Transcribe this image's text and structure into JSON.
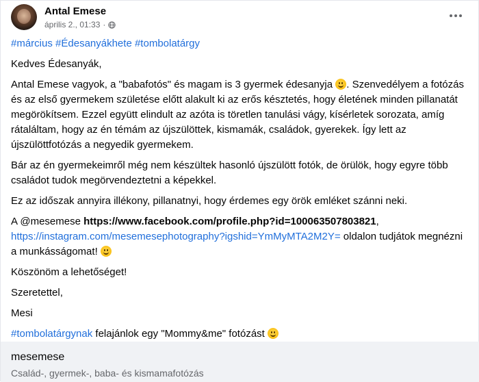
{
  "post": {
    "author": "Antal Emese",
    "timestamp": "április 2., 01:33",
    "separator": "·",
    "privacy_icon": "globe-icon",
    "more_icon": "more-options-icon",
    "hashtags": [
      "#március",
      "#Édesanyákhete",
      "#tombolatárgy"
    ],
    "greeting": "Kedves Édesanyák,",
    "p1_a": "Antal Emese vagyok, a \"babafotós\" és magam is 3 gyermek édesanyja ",
    "p1_b": ". Szenvedélyem a fotózás és az első gyermekem születése előtt alakult ki az erős késztetés, hogy életének minden pillanatát megörökítsem. Ezzel együtt elindult az azóta is töretlen tanulási vágy, kísérletek sorozata, amíg rátaláltam, hogy az én témám az újszülöttek, kismamák, családok, gyerekek. Így lett az újszülöttfotózás a negyedik gyermekem.",
    "p2": "Bár az én gyermekeimről még nem készültek hasonló újszülött fotók, de örülök, hogy egyre több családot tudok megörvendeztetni a képekkel.",
    "p3": "Ez az időszak annyira illékony, pillanatnyi, hogy érdemes egy örök emléket szánni neki.",
    "p4_a": "A @mesemese ",
    "p4_fb": "https://www.facebook.com/profile.php?id=100063507803821",
    "p4_comma": ",",
    "p4_ig": "https://instagram.com/mesemesephotography?igshid=YmMyMTA2M2Y=",
    "p4_b": " oldalon tudjátok megnézni a munkásságomat! ",
    "thanks": "Köszönöm a lehetőséget!",
    "regards": "Szeretettel,",
    "signature": "Mesi",
    "offer_tag": "#tombolatárgynak",
    "offer_text": " felajánlok egy \"Mommy&me\" fotózást ",
    "emoji": "smiling-face-emoji"
  },
  "link_preview": {
    "title": "mesemese",
    "subtitle": "Család-, gyermek-, baba- és kismamafotózás"
  },
  "colors": {
    "link": "#216fdb",
    "secondary_text": "#65676b",
    "footer_bg": "#f0f2f5"
  }
}
